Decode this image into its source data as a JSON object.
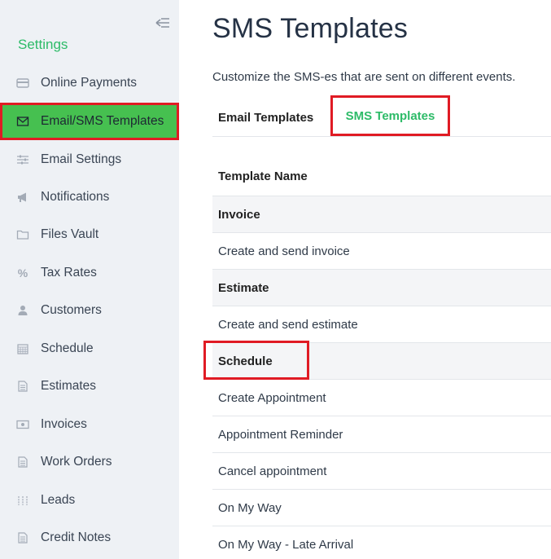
{
  "sidebar": {
    "title": "Settings",
    "items": [
      {
        "label": "Online Payments",
        "icon": "credit-card-icon"
      },
      {
        "label": "Email/SMS Templates",
        "icon": "envelope-icon",
        "active": true
      },
      {
        "label": "Email Settings",
        "icon": "sliders-icon"
      },
      {
        "label": "Notifications",
        "icon": "megaphone-icon"
      },
      {
        "label": "Files Vault",
        "icon": "folder-icon"
      },
      {
        "label": "Tax Rates",
        "icon": "percent-icon"
      },
      {
        "label": "Customers",
        "icon": "user-icon"
      },
      {
        "label": "Schedule",
        "icon": "calendar-icon"
      },
      {
        "label": "Estimates",
        "icon": "document-icon"
      },
      {
        "label": "Invoices",
        "icon": "money-icon"
      },
      {
        "label": "Work Orders",
        "icon": "document-icon"
      },
      {
        "label": "Leads",
        "icon": "leads-icon"
      },
      {
        "label": "Credit Notes",
        "icon": "document-icon"
      }
    ]
  },
  "main": {
    "title": "SMS Templates",
    "description": "Customize the SMS-es that are sent on different events.",
    "tabs": [
      {
        "label": "Email Templates",
        "active": false
      },
      {
        "label": "SMS Templates",
        "active": true
      }
    ],
    "table": {
      "header": "Template Name",
      "rows": [
        {
          "label": "Invoice",
          "type": "group"
        },
        {
          "label": "Create and send invoice",
          "type": "item"
        },
        {
          "label": "Estimate",
          "type": "group"
        },
        {
          "label": "Create and send estimate",
          "type": "item"
        },
        {
          "label": "Schedule",
          "type": "group"
        },
        {
          "label": "Create Appointment",
          "type": "item"
        },
        {
          "label": "Appointment Reminder",
          "type": "item"
        },
        {
          "label": "Cancel appointment",
          "type": "item"
        },
        {
          "label": "On My Way",
          "type": "item"
        },
        {
          "label": "On My Way - Late Arrival",
          "type": "item"
        }
      ]
    }
  },
  "colors": {
    "accent": "#2dbb68",
    "active_bg": "#46c050",
    "highlight": "#e01b24"
  }
}
